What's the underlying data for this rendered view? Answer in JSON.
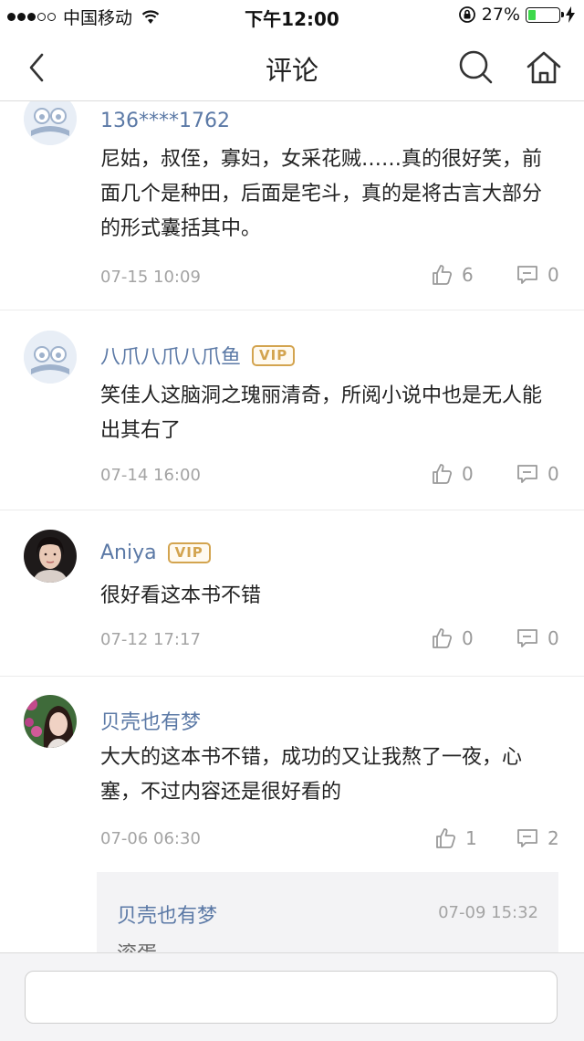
{
  "status_bar": {
    "carrier": "中国移动",
    "time": "下午12:00",
    "battery_percent": "27%",
    "battery_level": 0.27
  },
  "nav": {
    "title": "评论"
  },
  "comments": [
    {
      "user": "136****1762",
      "vip": false,
      "text": "尼姑，叔侄，寡妇，女采花贼……真的很好笑，前面几个是种田，后面是宅斗，真的是将古言大部分的形式囊括其中。",
      "time": "07-15 10:09",
      "likes": "6",
      "replies": "0"
    },
    {
      "user": "八爪八爪八爪鱼",
      "vip": true,
      "vip_label": "VIP",
      "text": "笑佳人这脑洞之瑰丽清奇，所阅小说中也是无人能出其右了",
      "time": "07-14 16:00",
      "likes": "0",
      "replies": "0"
    },
    {
      "user": "Aniya",
      "vip": true,
      "vip_label": "VIP",
      "text": "很好看这本书不错",
      "time": "07-12 17:17",
      "likes": "0",
      "replies": "0"
    },
    {
      "user": "贝壳也有梦",
      "vip": false,
      "text": "大大的这本书不错，成功的又让我熬了一夜，心塞，不过内容还是很好看的",
      "time": "07-06 06:30",
      "likes": "1",
      "replies": "2",
      "reply_preview": {
        "user": "贝壳也有梦",
        "time": "07-09 15:32",
        "text": "滚蛋"
      }
    }
  ],
  "colors": {
    "username": "#5b79a6",
    "vip": "#d3a44f",
    "meta": "#a4a4a4",
    "battery_fill": "#3dd84b"
  },
  "icons": [
    "back-icon",
    "search-icon",
    "home-icon",
    "like-icon",
    "reply-icon",
    "wifi-icon",
    "battery-icon"
  ],
  "input": {
    "placeholder": ""
  }
}
